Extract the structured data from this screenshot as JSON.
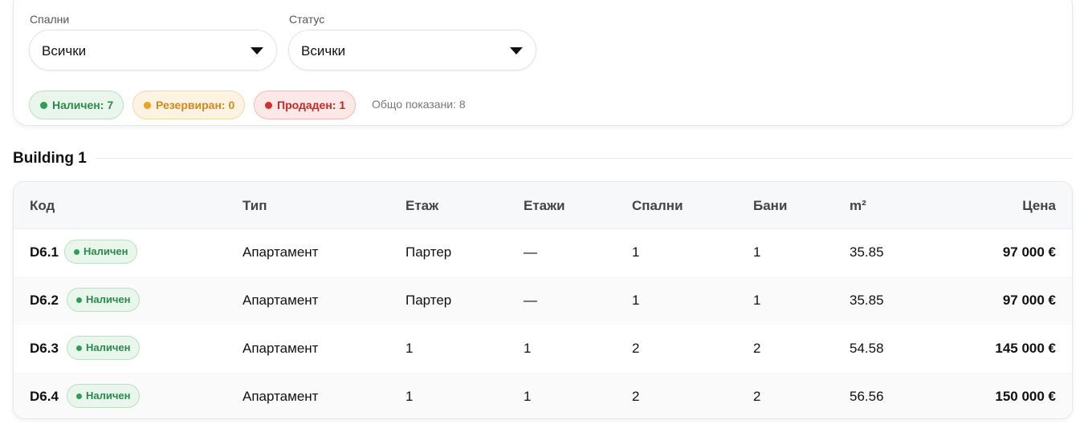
{
  "filters": {
    "bedrooms": {
      "label": "Спални",
      "value": "Всички"
    },
    "status": {
      "label": "Статус",
      "value": "Всички"
    }
  },
  "summary": {
    "available": "Наличен: 7",
    "reserved": "Резервиран: 0",
    "sold": "Продаден: 1",
    "total": "Общо показани: 8"
  },
  "colors": {
    "available": "#2e9e55",
    "reserved": "#f2a020",
    "sold": "#d32f2f"
  },
  "section": {
    "title": "Building 1"
  },
  "table": {
    "headers": {
      "code": "Код",
      "type": "Тип",
      "floor": "Етаж",
      "floors": "Етажи",
      "bedrooms": "Спални",
      "baths": "Бани",
      "area": "m²",
      "price": "Цена"
    },
    "rows": [
      {
        "code": "D6.1",
        "status": "Наличен",
        "type": "Апартамент",
        "floor": "Партер",
        "floors": "—",
        "bedrooms": "1",
        "baths": "1",
        "area": "35.85",
        "price": "97 000 €"
      },
      {
        "code": "D6.2",
        "status": "Наличен",
        "type": "Апартамент",
        "floor": "Партер",
        "floors": "—",
        "bedrooms": "1",
        "baths": "1",
        "area": "35.85",
        "price": "97 000 €"
      },
      {
        "code": "D6.3",
        "status": "Наличен",
        "type": "Апартамент",
        "floor": "1",
        "floors": "1",
        "bedrooms": "2",
        "baths": "2",
        "area": "54.58",
        "price": "145 000 €"
      },
      {
        "code": "D6.4",
        "status": "Наличен",
        "type": "Апартамент",
        "floor": "1",
        "floors": "1",
        "bedrooms": "2",
        "baths": "2",
        "area": "56.56",
        "price": "150 000 €"
      }
    ]
  }
}
